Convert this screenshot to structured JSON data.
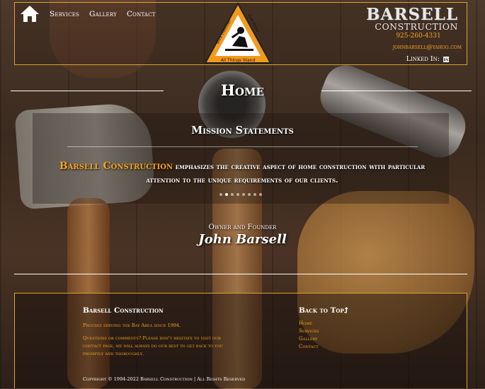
{
  "nav": {
    "home_label": "Home",
    "items": [
      {
        "label": "Services"
      },
      {
        "label": "Gallery"
      },
      {
        "label": "Contact"
      }
    ]
  },
  "logo": {
    "left_text": "With Hammer",
    "right_text": "And Hand",
    "bottom_text": "All Things Stand"
  },
  "brand": {
    "line1": "BARSELL",
    "line2": "CONSTRUCTION"
  },
  "contact": {
    "phone": "925-260-4331",
    "email": "johnbarsell@yahoo.com",
    "linkedin_label": "Linked In:"
  },
  "page": {
    "title": "Home"
  },
  "mission": {
    "title": "Mission Statements",
    "brand_name": "Barsell Construction",
    "text": " emphasizes the creative aspect of home construction with particular attention to the unique requirements of our clients.",
    "slide_count": 8,
    "active_slide": 1
  },
  "owner": {
    "label": "Owner and Founder",
    "name": "John Barsell"
  },
  "footer": {
    "company": "Barsell Construction",
    "tagline": "Proudly serving the Bay Area since 1994.",
    "message": "Questions or comments? Please don't hesitate to visit our contact page, we will always do our best to get back to you promptly and thoroughly.",
    "back_to_top": "Back to Top",
    "links": [
      {
        "label": "Home"
      },
      {
        "label": "Services"
      },
      {
        "label": "Gallery"
      },
      {
        "label": "Contact"
      }
    ],
    "copyright": "Copyright © 1994-2022 Barsell Construction | All Rights Reserved"
  },
  "colors": {
    "accent": "#f5a623",
    "border": "#d9a22d",
    "logo_orange": "#f39a1d"
  }
}
